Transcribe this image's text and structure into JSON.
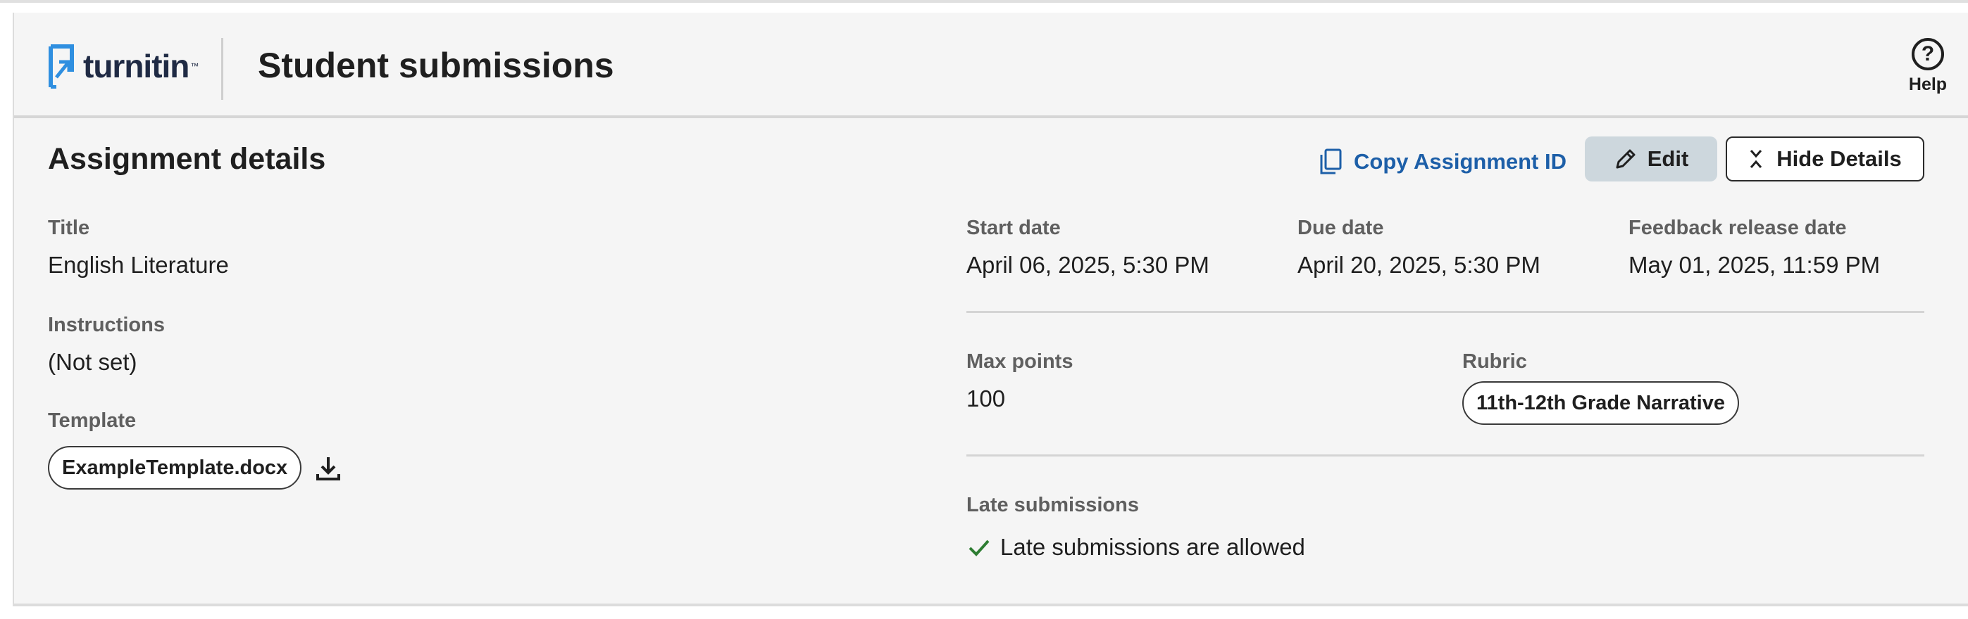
{
  "header": {
    "logo_text": "turnitin",
    "logo_tm": "™",
    "page_title": "Student submissions",
    "help_label": "Help"
  },
  "details": {
    "section_title": "Assignment details",
    "copy_label": "Copy Assignment ID",
    "edit_label": "Edit",
    "hide_label": "Hide Details",
    "title_label": "Title",
    "title_value": "English Literature",
    "instructions_label": "Instructions",
    "instructions_value": "(Not set)",
    "template_label": "Template",
    "template_file": "ExampleTemplate.docx",
    "start_label": "Start date",
    "start_value": "April 06, 2025, 5:30 PM",
    "due_label": "Due date",
    "due_value": "April 20, 2025, 5:30 PM",
    "feedback_label": "Feedback release date",
    "feedback_value": "May 01, 2025, 11:59 PM",
    "max_points_label": "Max points",
    "max_points_value": "100",
    "rubric_label": "Rubric",
    "rubric_value": "11th-12th Grade Narrative",
    "late_label": "Late submissions",
    "late_value": "Late submissions are allowed"
  },
  "icons": {
    "logo": "turnitin-logo-icon",
    "help": "help-icon",
    "copy": "copy-icon",
    "edit": "pencil-icon",
    "hide": "collapse-icon",
    "download": "download-icon",
    "check": "check-icon"
  },
  "colors": {
    "accent_link": "#1d5fa8",
    "logo_blue": "#2f8fe0",
    "edit_bg": "#cdd7dd",
    "check_green": "#2e7d32"
  }
}
